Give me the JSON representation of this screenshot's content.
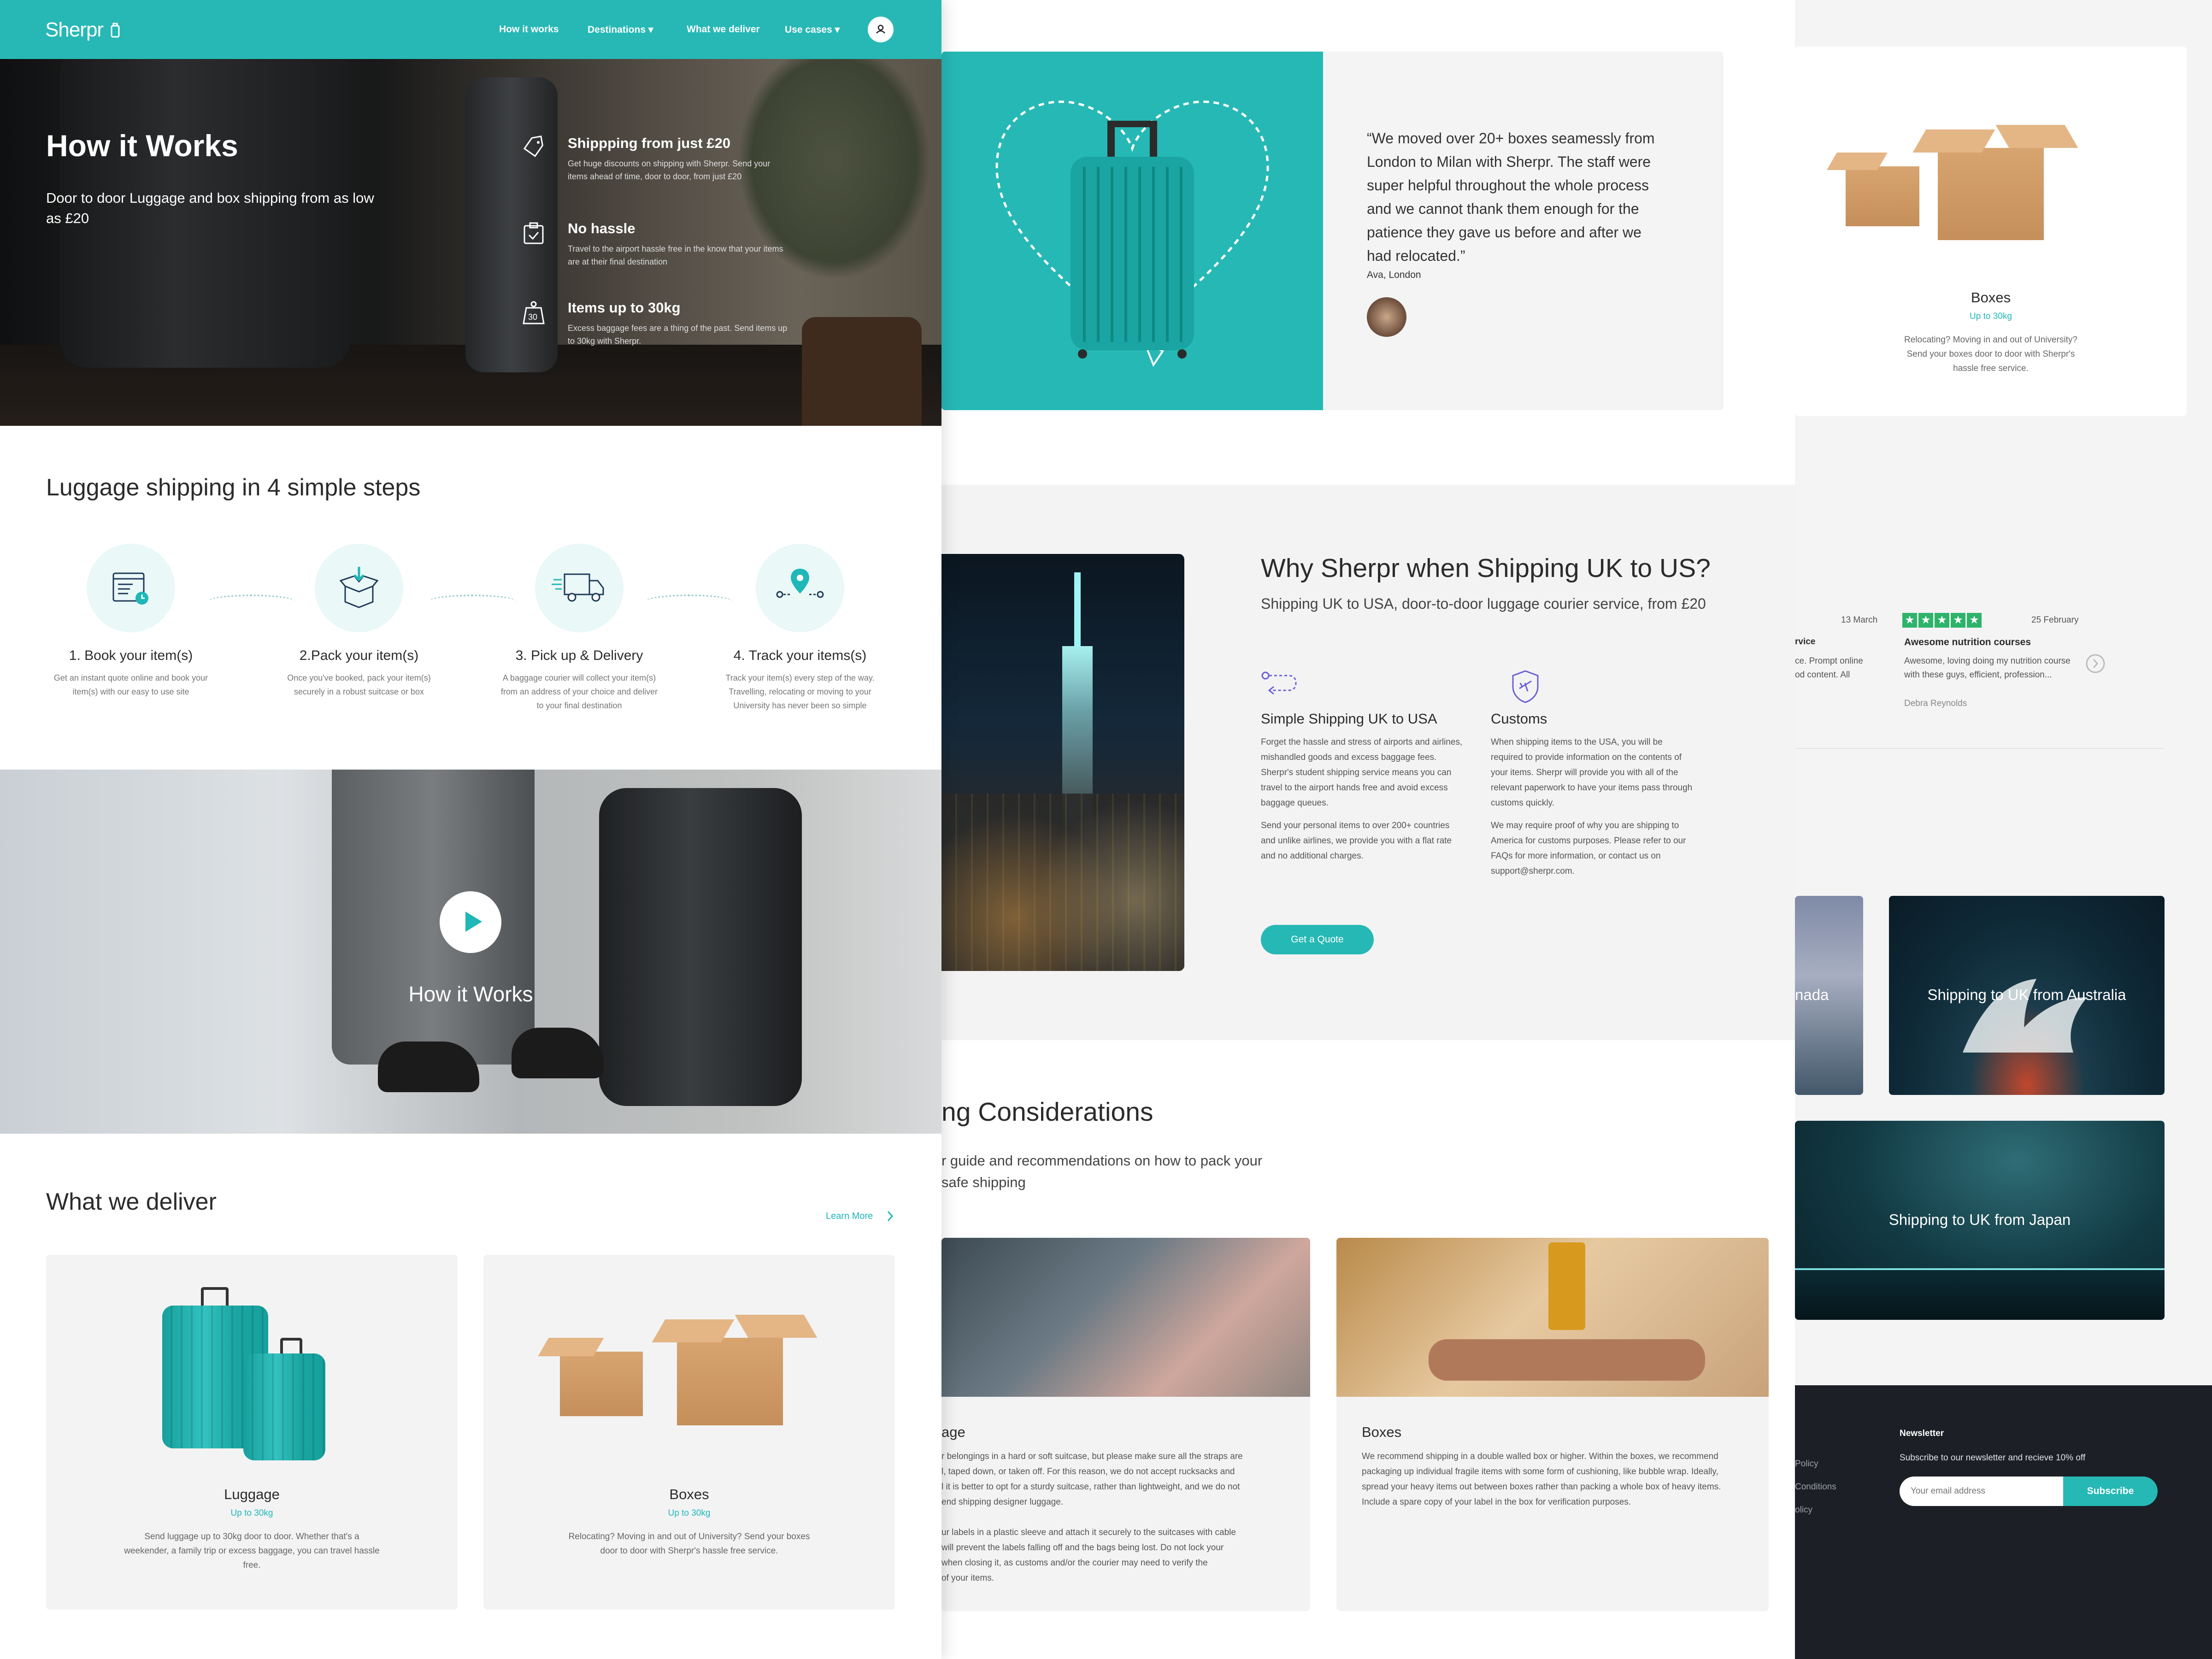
{
  "brand": {
    "logo": "Sherpr",
    "accent": "#27b8b5"
  },
  "nav": {
    "items": [
      "How it works",
      "Destinations ▾",
      "What we deliver",
      "Use cases ▾"
    ]
  },
  "hero": {
    "title": "How it Works",
    "subtitle": "Door to door Luggage and box shipping from as low as £20",
    "features": [
      {
        "icon": "price-tag-icon",
        "title": "Shippping from just £20",
        "text": "Get huge discounts on shipping with Sherpr. Send your items ahead of time, door to door, from just £20"
      },
      {
        "icon": "clipboard-check-icon",
        "title": "No hassle",
        "text": "Travel to the airport hassle free in the know that your items are at their final destination"
      },
      {
        "icon": "weight-30-icon",
        "title": "Items up to 30kg",
        "text": "Excess baggage fees are a thing of the past. Send items up to 30kg with Sherpr."
      }
    ]
  },
  "steps": {
    "heading": "Luggage shipping in 4 simple steps",
    "items": [
      {
        "icon": "booking-screen-icon",
        "title": "1. Book your item(s)",
        "text": "Get an instant quote online and book your item(s) with our easy to use site"
      },
      {
        "icon": "open-box-icon",
        "title": "2.Pack your item(s)",
        "text": "Once you've booked, pack your item(s) securely in a robust suitcase or box"
      },
      {
        "icon": "delivery-truck-icon",
        "title": "3. Pick up & Delivery",
        "text": "A baggage courier will collect your item(s) from an address of your choice and deliver to your final destination"
      },
      {
        "icon": "location-pin-icon",
        "title": "4. Track your items(s)",
        "text": "Track your item(s) every step of the way. Travelling, relocating or moving to your University has never been so simple"
      }
    ]
  },
  "video": {
    "title": "How it Works"
  },
  "deliver": {
    "heading": "What we deliver",
    "learn_more": "Learn More",
    "cards": [
      {
        "title": "Luggage",
        "limit": "Up to 30kg",
        "text": "Send luggage up to 30kg door to door. Whether that's a weekender, a family trip or excess baggage, you can travel hassle free."
      },
      {
        "title": "Boxes",
        "limit": "Up to 30kg",
        "text": "Relocating? Moving in and out of University? Send your boxes door to door with Sherpr's hassle free service."
      }
    ]
  },
  "testimonial": {
    "quote": "“We moved over 20+ boxes seamessly from London to Milan with Sherpr. The staff were super helpful throughout the whole process and we cannot thank them enough for the patience they gave us before and after we had relocated.”",
    "author": "Ava, London"
  },
  "why": {
    "title": "Why Sherpr when Shipping UK to US?",
    "subtitle": "Shipping UK to USA, door-to-door luggage courier service, from £20",
    "col1": {
      "icon": "route-icon",
      "title": "Simple Shipping UK to USA",
      "p1": "Forget the hassle and stress of airports and airlines, mishandled goods and excess baggage fees. Sherpr's student shipping service means you can travel to the airport hands free and avoid excess baggage queues.",
      "p2": "Send your personal items to over 200+ countries and unlike airlines, we provide you with a flat rate and no additional charges."
    },
    "col2": {
      "icon": "shield-plane-icon",
      "title": "Customs",
      "p1": "When shipping items to the USA, you will be required to provide information on the contents of your items. Sherpr will provide you with all of the relevant paperwork to have your items pass through customs quickly.",
      "p2": "We may require proof of why you are shipping to America for customs purposes. Please refer to our FAQs for more information, or contact us on support@sherpr.com."
    },
    "cta": "Get a Quote"
  },
  "packing": {
    "title": "ng Considerations",
    "subtitle_l1": "r guide and recommendations on how to pack your",
    "subtitle_l2": "safe shipping",
    "cards": [
      {
        "title": "age",
        "lines": [
          "r belongings in a hard or soft suitcase, but please make sure all the straps are",
          "l, taped down, or taken off. For this reason, we do not accept rucksacks and",
          "l it is better to opt for a sturdy suitcase, rather than lightweight, and we do not",
          "end shipping designer luggage.",
          "",
          "ur labels in a plastic sleeve and attach it securely to the suitcases with cable",
          "will prevent the labels falling off and the bags being lost. Do not lock your",
          "when closing it, as customs and/or the courier may need to verify the",
          "of your items."
        ]
      },
      {
        "title": "Boxes",
        "text": "We recommend shipping in a double walled box or higher. Within the boxes, we recommend packaging up individual fragile items with some form of cushioning, like bubble wrap. Ideally, spread your heavy items out between boxes rather than packing a whole box of heavy items. Include a spare copy of your label in the box for verification purposes."
      }
    ]
  },
  "panel3": {
    "boxes_card": {
      "title": "Boxes",
      "limit": "Up to 30kg",
      "text": "Relocating? Moving in and out of University? Send your boxes door to door with Sherpr's hassle free service."
    },
    "reviews": [
      {
        "date": "13 March",
        "title": "rvice",
        "text_l1": "ce. Prompt online",
        "text_l2": "od content. All"
      },
      {
        "date": "25 February",
        "title": "Awesome nutrition courses",
        "text": "Awesome, loving doing my nutrition course with these guys, efficient, profession...",
        "author": "Debra Reynolds"
      }
    ],
    "destinations": [
      "nada",
      "Shipping to UK from Australia",
      "Shipping to UK from Japan"
    ],
    "footer": {
      "links": [
        "Policy",
        "Conditions",
        "olicy"
      ],
      "newsletter_title": "Newsletter",
      "newsletter_text": "Subscribe to our newsletter and recieve 10% off",
      "email_placeholder": "Your email address",
      "subscribe": "Subscribe"
    }
  }
}
